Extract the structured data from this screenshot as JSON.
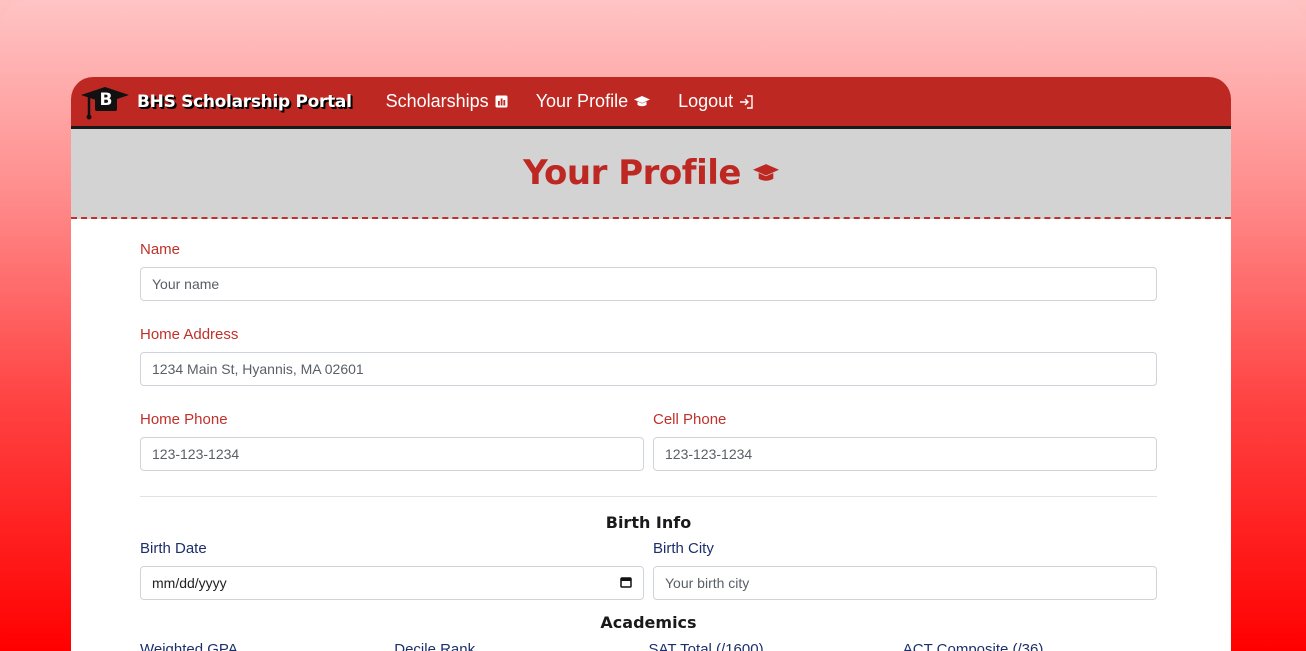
{
  "navbar": {
    "logo_letter": "B",
    "brand": "BHS Scholarship Portal",
    "links": [
      {
        "label": "Scholarships",
        "icon": "chart-icon"
      },
      {
        "label": "Your Profile",
        "icon": "graduation-cap-icon"
      },
      {
        "label": "Logout",
        "icon": "sign-in-icon"
      }
    ]
  },
  "hero": {
    "title": "Your Profile",
    "icon": "graduation-cap-icon"
  },
  "form": {
    "name": {
      "label": "Name",
      "placeholder": "Your name"
    },
    "address": {
      "label": "Home Address",
      "placeholder": "1234 Main St, Hyannis, MA 02601"
    },
    "home_phone": {
      "label": "Home Phone",
      "placeholder": "123-123-1234"
    },
    "cell_phone": {
      "label": "Cell Phone",
      "placeholder": "123-123-1234"
    },
    "birth_section": "Birth Info",
    "birth_date": {
      "label": "Birth Date",
      "placeholder": "mm/dd/yyyy"
    },
    "birth_city": {
      "label": "Birth City",
      "placeholder": "Your birth city"
    },
    "academics_section": "Academics",
    "academics": [
      {
        "label": "Weighted GPA"
      },
      {
        "label": "Decile Rank"
      },
      {
        "label": "SAT Total (/1600)"
      },
      {
        "label": "ACT Composite (/36)"
      }
    ]
  },
  "colors": {
    "primary": "#bd2822",
    "label_red": "#c0312b",
    "label_blue": "#1d2f6b",
    "hero_bg": "#d3d3d3"
  }
}
